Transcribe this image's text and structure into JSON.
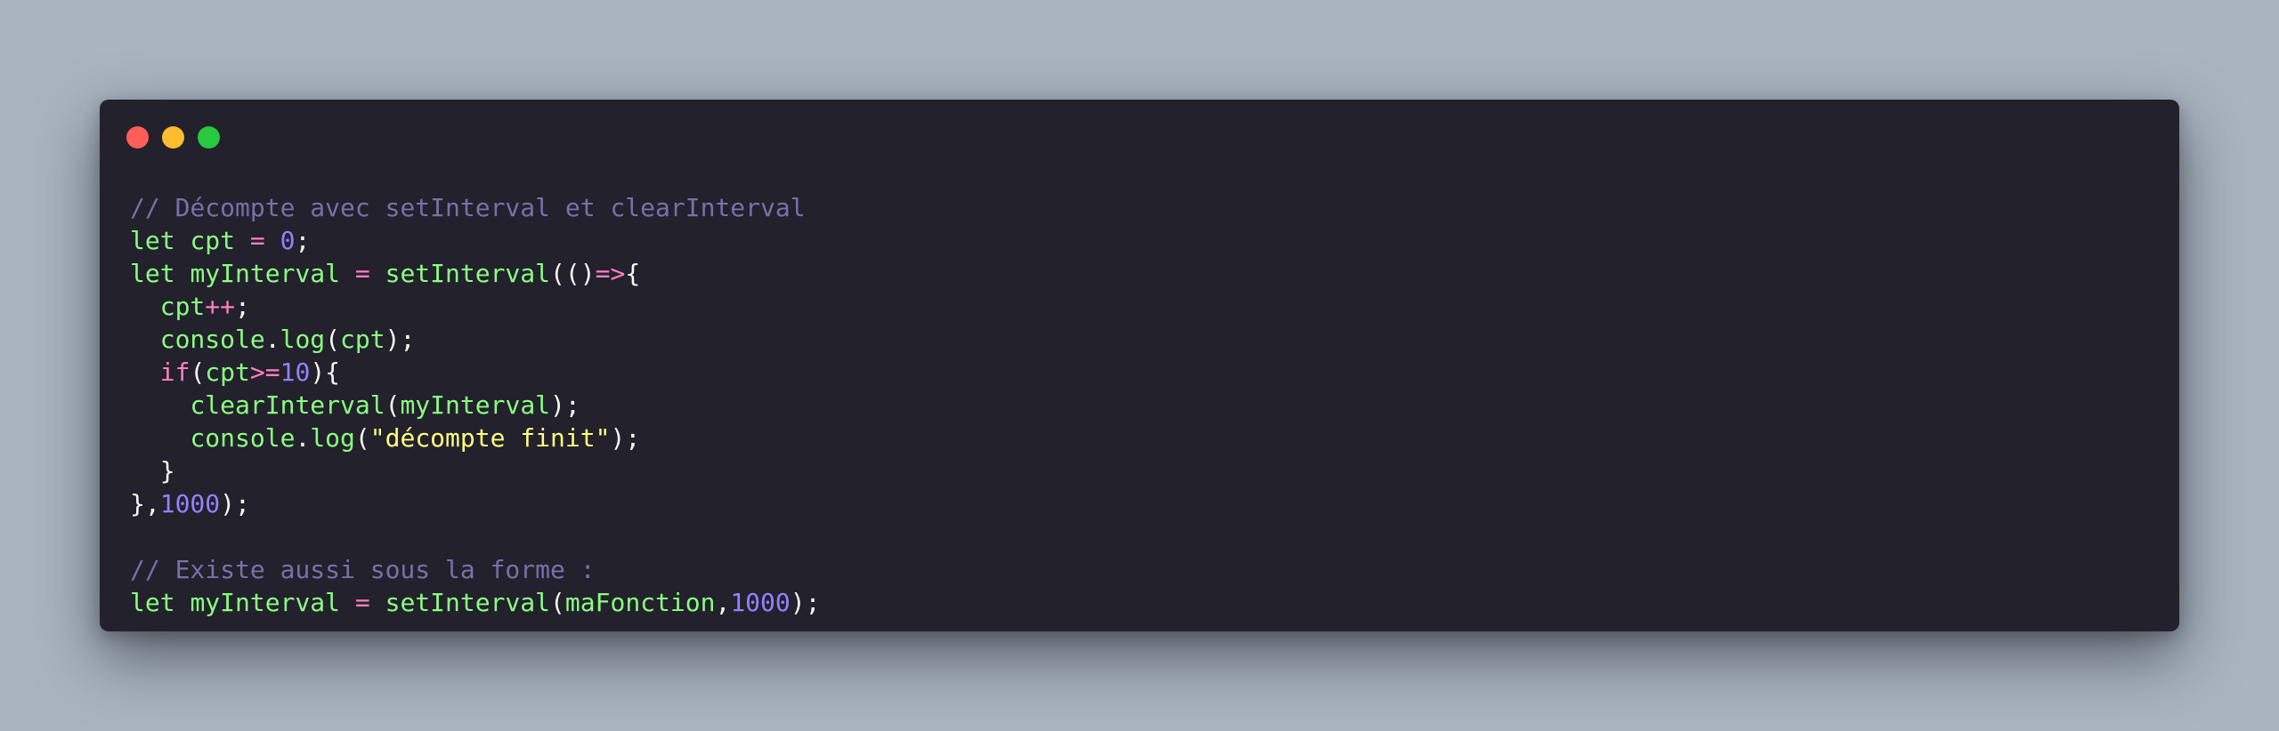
{
  "window": {
    "controls": [
      "close",
      "minimize",
      "maximize"
    ],
    "colors": {
      "background": "#22212c",
      "page_background": "#a9b4bf",
      "close": "#ff5f57",
      "minimize": "#febc2e",
      "maximize": "#28c840"
    }
  },
  "code": {
    "language": "javascript",
    "lines": [
      [
        {
          "t": "// Décompte avec setInterval et clearInterval",
          "c": "comment"
        }
      ],
      [
        {
          "t": "let",
          "c": "keyword"
        },
        {
          "t": " ",
          "c": "plain"
        },
        {
          "t": "cpt",
          "c": "var"
        },
        {
          "t": " ",
          "c": "plain"
        },
        {
          "t": "=",
          "c": "op"
        },
        {
          "t": " ",
          "c": "plain"
        },
        {
          "t": "0",
          "c": "num"
        },
        {
          "t": ";",
          "c": "punc"
        }
      ],
      [
        {
          "t": "let",
          "c": "keyword"
        },
        {
          "t": " ",
          "c": "plain"
        },
        {
          "t": "myInterval",
          "c": "var"
        },
        {
          "t": " ",
          "c": "plain"
        },
        {
          "t": "=",
          "c": "op"
        },
        {
          "t": " ",
          "c": "plain"
        },
        {
          "t": "setInterval",
          "c": "fn"
        },
        {
          "t": "(()",
          "c": "punc"
        },
        {
          "t": "=>",
          "c": "op"
        },
        {
          "t": "{",
          "c": "punc"
        }
      ],
      [
        {
          "t": "  ",
          "c": "plain"
        },
        {
          "t": "cpt",
          "c": "var"
        },
        {
          "t": "++",
          "c": "op"
        },
        {
          "t": ";",
          "c": "punc"
        }
      ],
      [
        {
          "t": "  ",
          "c": "plain"
        },
        {
          "t": "console",
          "c": "var"
        },
        {
          "t": ".",
          "c": "punc"
        },
        {
          "t": "log",
          "c": "fn"
        },
        {
          "t": "(",
          "c": "punc"
        },
        {
          "t": "cpt",
          "c": "var"
        },
        {
          "t": ");",
          "c": "punc"
        }
      ],
      [
        {
          "t": "  ",
          "c": "plain"
        },
        {
          "t": "if",
          "c": "ctrl"
        },
        {
          "t": "(",
          "c": "punc"
        },
        {
          "t": "cpt",
          "c": "var"
        },
        {
          "t": ">=",
          "c": "op"
        },
        {
          "t": "10",
          "c": "num"
        },
        {
          "t": "){",
          "c": "punc"
        }
      ],
      [
        {
          "t": "    ",
          "c": "plain"
        },
        {
          "t": "clearInterval",
          "c": "fn"
        },
        {
          "t": "(",
          "c": "punc"
        },
        {
          "t": "myInterval",
          "c": "var"
        },
        {
          "t": ");",
          "c": "punc"
        }
      ],
      [
        {
          "t": "    ",
          "c": "plain"
        },
        {
          "t": "console",
          "c": "var"
        },
        {
          "t": ".",
          "c": "punc"
        },
        {
          "t": "log",
          "c": "fn"
        },
        {
          "t": "(",
          "c": "punc"
        },
        {
          "t": "\"décompte finit\"",
          "c": "str"
        },
        {
          "t": ");",
          "c": "punc"
        }
      ],
      [
        {
          "t": "  }",
          "c": "punc"
        }
      ],
      [
        {
          "t": "},",
          "c": "punc"
        },
        {
          "t": "1000",
          "c": "num"
        },
        {
          "t": ");",
          "c": "punc"
        }
      ],
      [],
      [
        {
          "t": "// Existe aussi sous la forme :",
          "c": "comment"
        }
      ],
      [
        {
          "t": "let",
          "c": "keyword"
        },
        {
          "t": " ",
          "c": "plain"
        },
        {
          "t": "myInterval",
          "c": "var"
        },
        {
          "t": " ",
          "c": "plain"
        },
        {
          "t": "=",
          "c": "op"
        },
        {
          "t": " ",
          "c": "plain"
        },
        {
          "t": "setInterval",
          "c": "fn"
        },
        {
          "t": "(",
          "c": "punc"
        },
        {
          "t": "maFonction",
          "c": "var"
        },
        {
          "t": ",",
          "c": "punc"
        },
        {
          "t": "1000",
          "c": "num"
        },
        {
          "t": ");",
          "c": "punc"
        }
      ]
    ]
  }
}
